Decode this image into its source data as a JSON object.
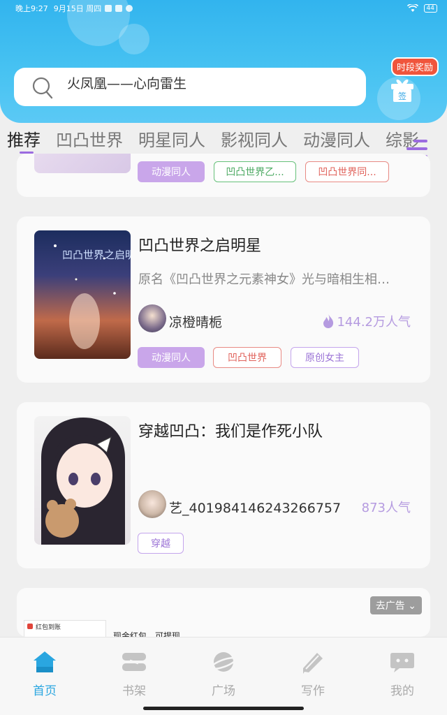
{
  "status_bar": {
    "time": "晚上9:27",
    "date": "9月15日 周四",
    "battery": "44"
  },
  "search": {
    "text": "火凤凰——心向雷生",
    "icon": "search-icon"
  },
  "reward": {
    "badge": "时段奖励",
    "gift_label": "签"
  },
  "tabs": [
    "推荐",
    "凹凸世界",
    "明星同人",
    "影视同人",
    "动漫同人",
    "综影"
  ],
  "cards": [
    {
      "tags": [
        "动漫同人",
        "凹凸世界乙...",
        "凹凸世界同..."
      ]
    },
    {
      "title": "凹凸世界之启明星",
      "cover_text": "凹凸世界之启明星",
      "desc": "原名《凹凸世界之元素神女》光与暗相生相…",
      "author": "凉橙晴栀",
      "popularity": "144.2万人气",
      "tags": [
        "动漫同人",
        "凹凸世界",
        "原创女主"
      ]
    },
    {
      "title": "穿越凹凸：我们是作死小队",
      "author": "艺_401984146243266757",
      "popularity": "873人气",
      "tags": [
        "穿越"
      ]
    }
  ],
  "ad": {
    "button": "去广告",
    "text": "现金红包，可提现",
    "thumb_text": "红包到账"
  },
  "bottom_nav": [
    {
      "label": "首页",
      "icon": "home-icon",
      "active": true
    },
    {
      "label": "书架",
      "icon": "bookshelf-icon",
      "active": false
    },
    {
      "label": "广场",
      "icon": "planet-icon",
      "active": false
    },
    {
      "label": "写作",
      "icon": "pen-icon",
      "active": false
    },
    {
      "label": "我的",
      "icon": "chat-bubble-icon",
      "active": false
    }
  ],
  "colors": {
    "header": "#3db9f0",
    "accent": "#9b6be0",
    "nav_active": "#2aa6e0",
    "popularity": "#b59be0"
  }
}
